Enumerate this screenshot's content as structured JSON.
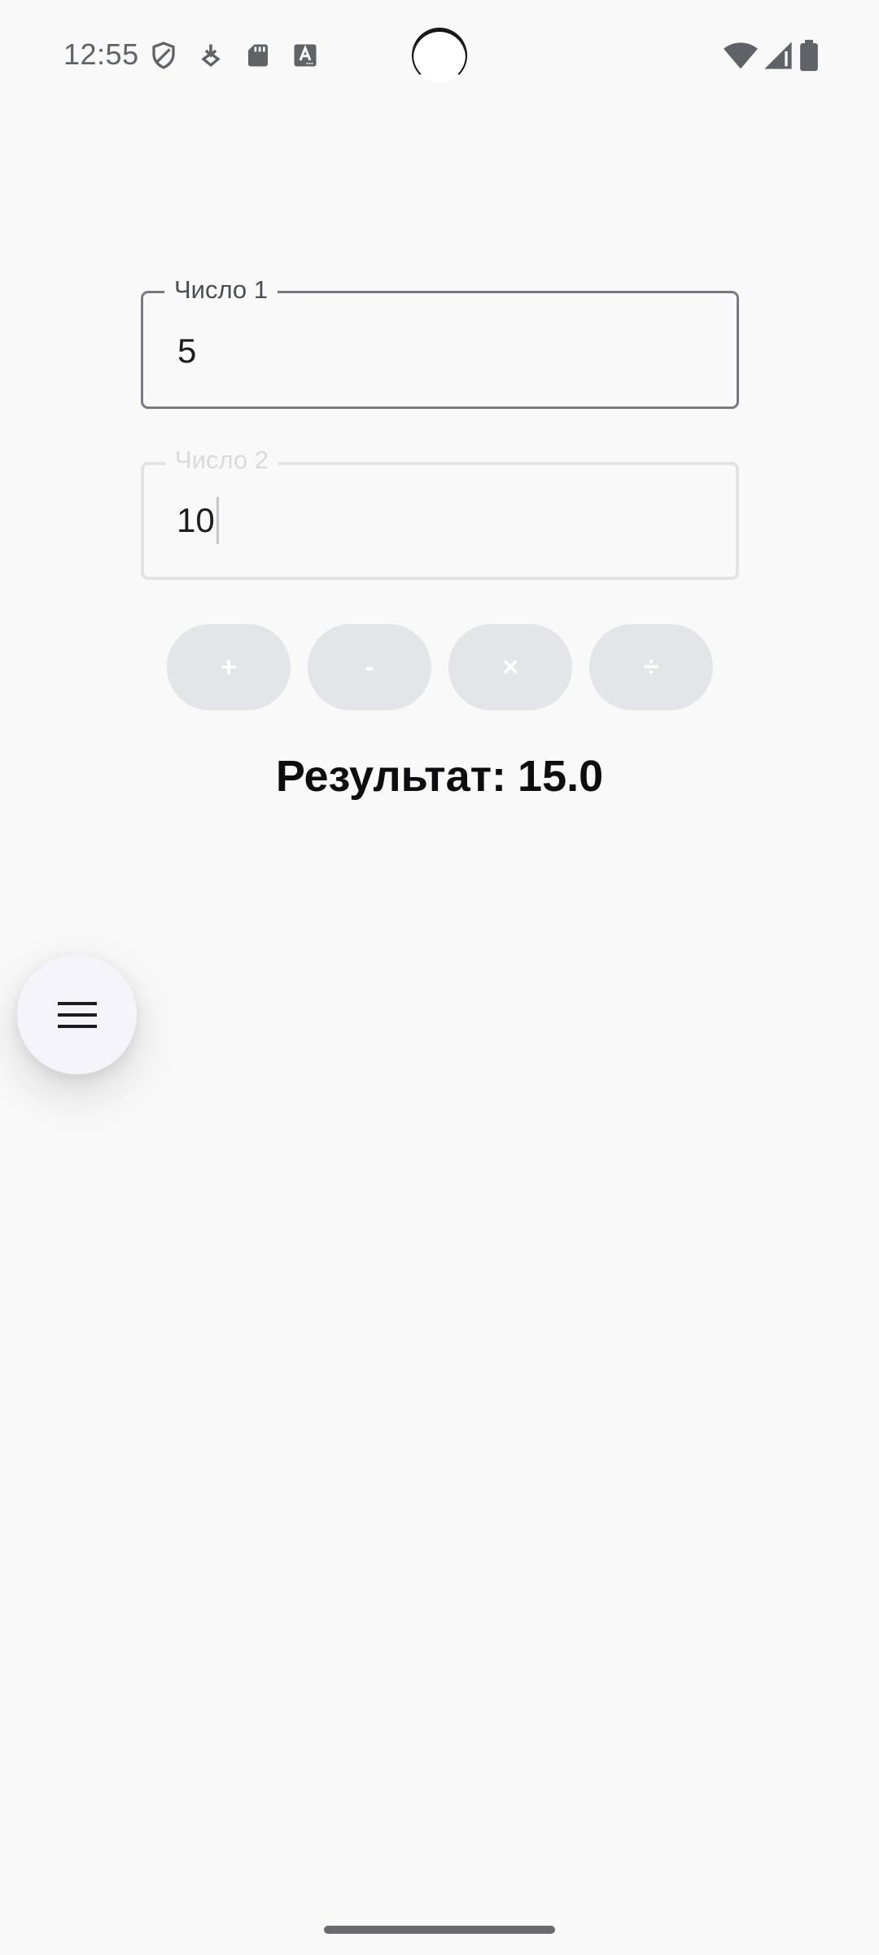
{
  "status_bar": {
    "time": "12:55",
    "left_icons": [
      "shield-icon",
      "download-icon",
      "sd-card-icon",
      "font-a-icon"
    ],
    "right_icons": [
      "wifi-icon",
      "cellular-signal-icon",
      "battery-icon"
    ],
    "icon_color": "#5f6368"
  },
  "form": {
    "field1": {
      "label": "Число 1",
      "value": "5"
    },
    "field2": {
      "label": "Число 2",
      "value": "10"
    }
  },
  "operations": [
    {
      "label": "+"
    },
    {
      "label": "-"
    },
    {
      "label": "×"
    },
    {
      "label": "÷"
    }
  ],
  "result": {
    "label": "Результат:",
    "value": "15.0"
  },
  "fab": {
    "icon": "menu-icon"
  },
  "colors": {
    "background": "#f9f9f9",
    "field_border_active": "#777a80",
    "field_border_disabled": "#e3e3e5",
    "button_background": "#e4e5e8",
    "result_text": "#0d0d0f",
    "fab_background": "#f4f4fa"
  }
}
